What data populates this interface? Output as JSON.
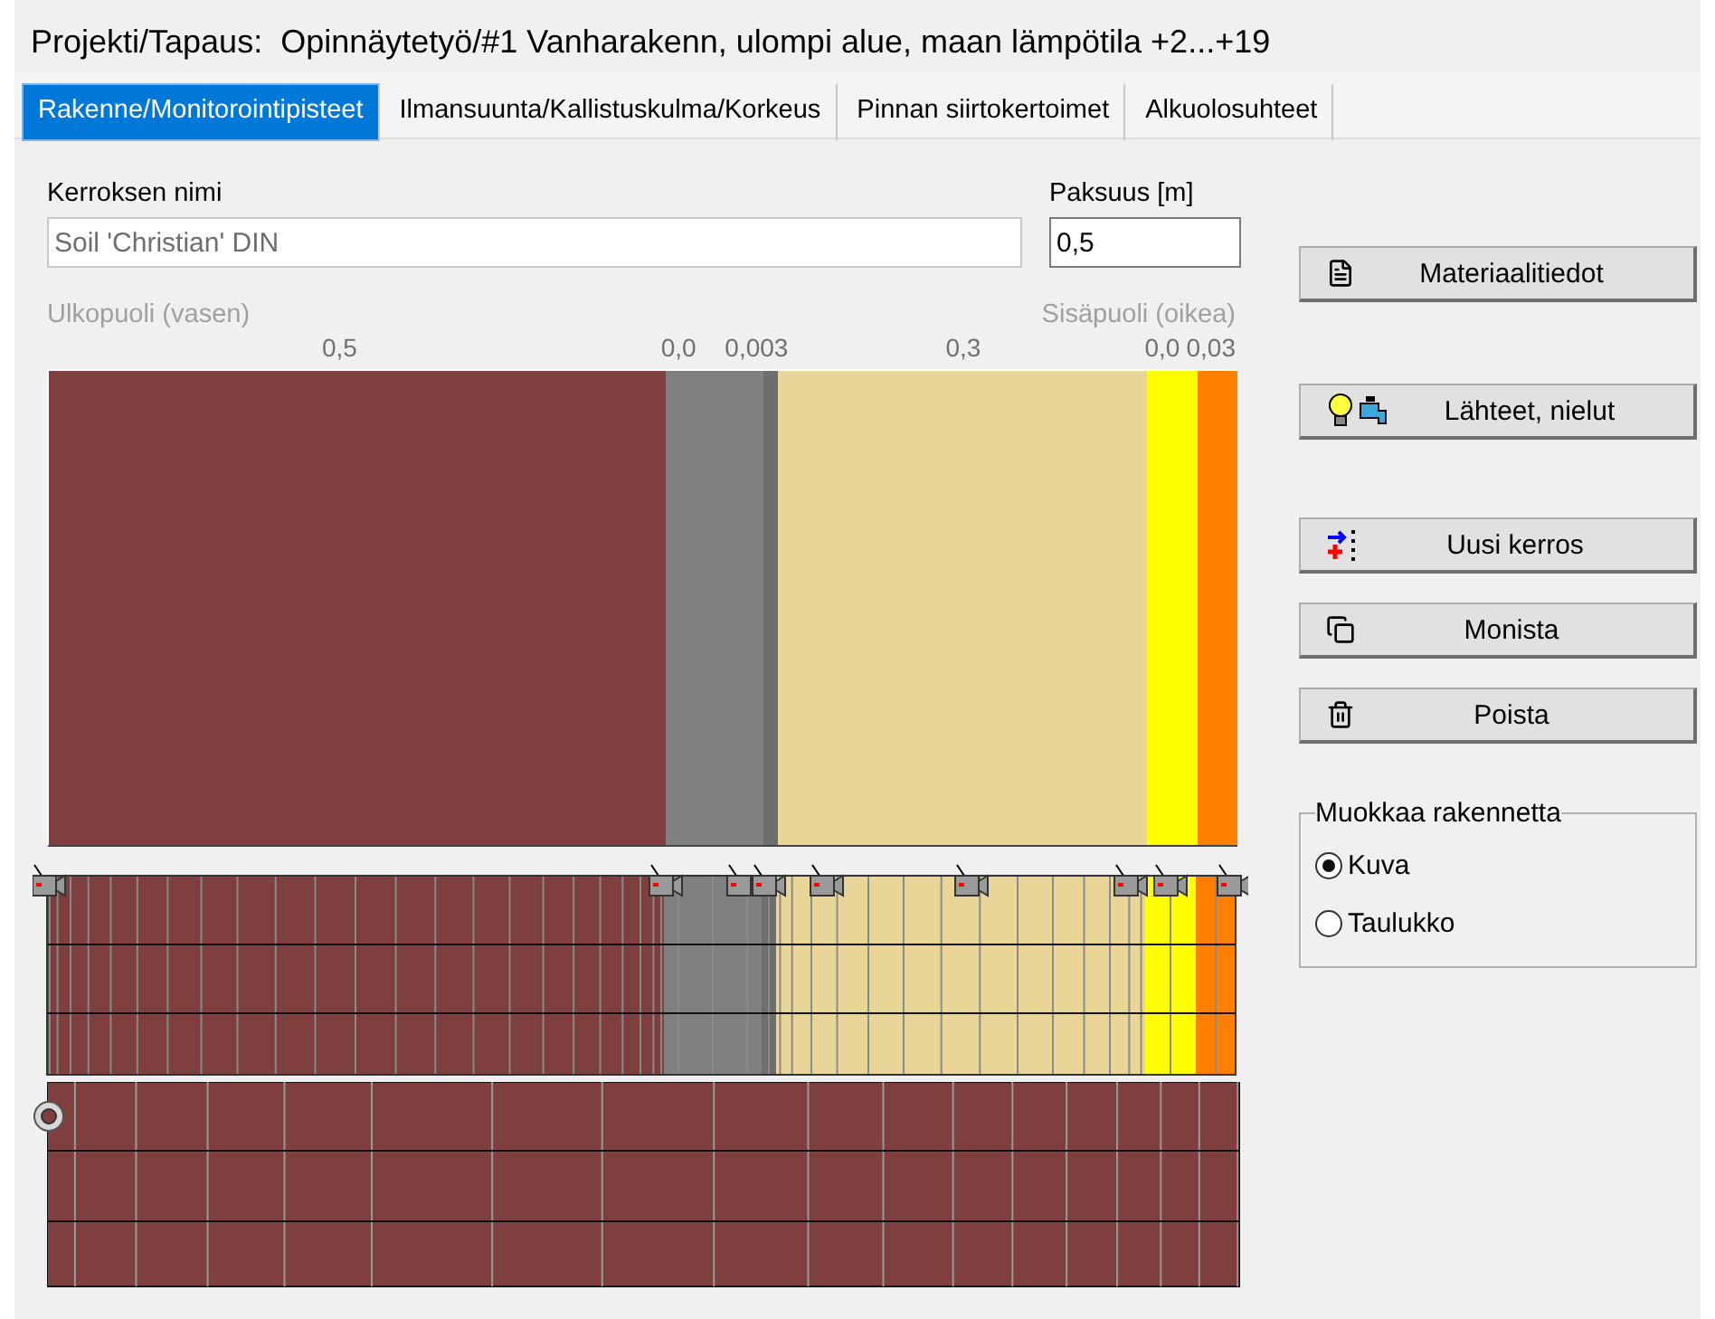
{
  "title": {
    "label": "Projekti/Tapaus:",
    "value": "Opinnäytetyö/#1 Vanharakenn, ulompi alue, maan lämpötila +2...+19"
  },
  "tabs": [
    {
      "label": "Rakenne/Monitorointipisteet",
      "selected": true
    },
    {
      "label": "Ilmansuunta/Kallistuskulma/Korkeus",
      "selected": false
    },
    {
      "label": "Pinnan siirtokertoimet",
      "selected": false
    },
    {
      "label": "Alkuolosuhteet",
      "selected": false
    }
  ],
  "layer_name": {
    "label": "Kerroksen nimi",
    "value": "Soil 'Christian' DIN"
  },
  "thickness": {
    "label": "Paksuus [m]",
    "value": "0,5"
  },
  "diagram": {
    "left_label": "Ulkopuoli (vasen)",
    "right_label": "Sisäpuoli (oikea)",
    "layers": [
      {
        "label": "0,5",
        "color": "#7f3f3f"
      },
      {
        "label": "0,0",
        "color": "#808080"
      },
      {
        "label": "0,003",
        "color": "#6e6e6e"
      },
      {
        "label": "0,3",
        "color": "#ead598"
      },
      {
        "label": "0,0",
        "color": "#ffff00"
      },
      {
        "label": "0,03",
        "color": "#ff8000"
      }
    ]
  },
  "buttons": [
    {
      "kind": "info",
      "label": "Materiaalitiedot"
    },
    {
      "kind": "sources",
      "label": "Lähteet, nielut"
    },
    {
      "kind": "new",
      "label": "Uusi kerros"
    },
    {
      "kind": "copy",
      "label": "Monista"
    },
    {
      "kind": "delete",
      "label": "Poista"
    }
  ],
  "edit_mode": {
    "title": "Muokkaa rakennetta",
    "options": [
      {
        "label": "Kuva",
        "selected": true
      },
      {
        "label": "Taulukko",
        "selected": false
      }
    ]
  }
}
